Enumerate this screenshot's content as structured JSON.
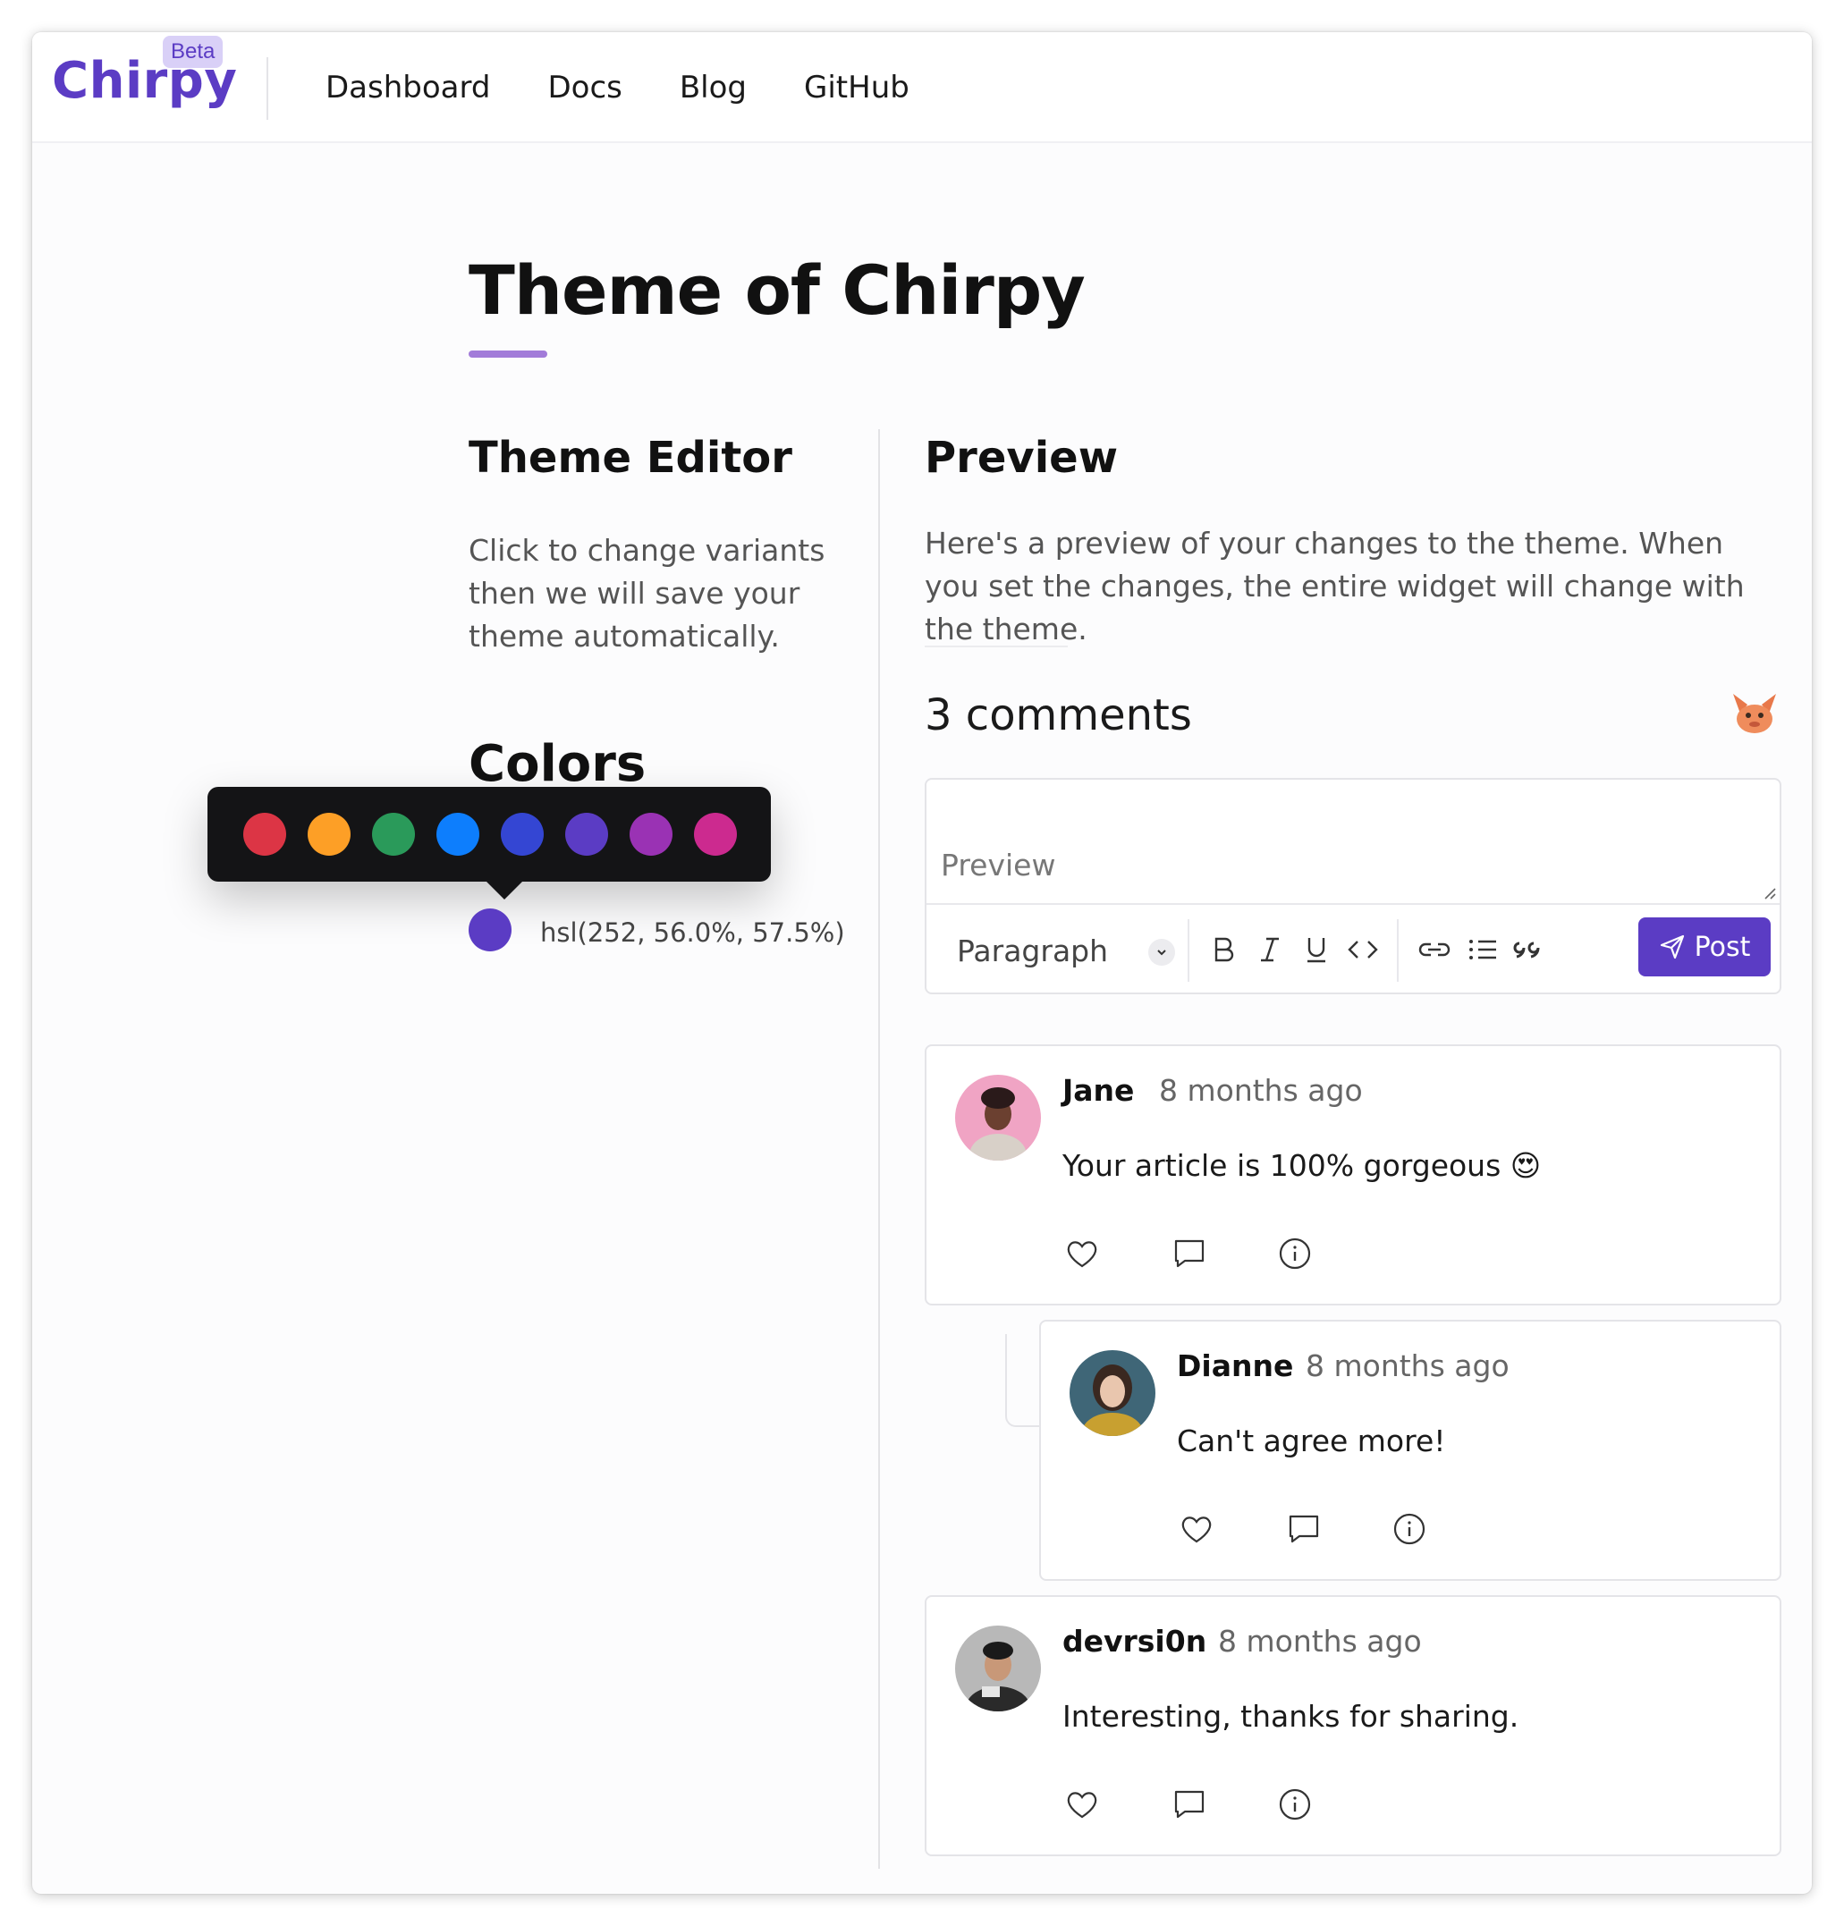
{
  "header": {
    "logo": "Chirpy",
    "badge": "Beta",
    "nav": [
      {
        "label": "Dashboard"
      },
      {
        "label": "Docs"
      },
      {
        "label": "Blog"
      },
      {
        "label": "GitHub"
      }
    ]
  },
  "page": {
    "title": "Theme of Chirpy"
  },
  "editor": {
    "title": "Theme Editor",
    "description": "Click to change variants then we will save your theme automatically.",
    "colors_title": "Colors",
    "palette": [
      "#dc3545",
      "#fd9f26",
      "#2a9a5a",
      "#0d7efd",
      "#3446d3",
      "#5b3cc4",
      "#9a32b4",
      "#cc2a8f"
    ],
    "selected_color": "#5b3cc4",
    "selected_label": "hsl(252, 56.0%, 57.5%)"
  },
  "preview": {
    "title": "Preview",
    "description": "Here's a preview of your changes to the theme. When you set the changes, the entire widget will change with the theme.",
    "comments_count": "3 comments",
    "input_placeholder": "Preview",
    "format_select": "Paragraph",
    "post_label": "Post",
    "accent": "#5b3cc4"
  },
  "comments": [
    {
      "author": "Jane",
      "time": "8 months ago",
      "text": "Your article is 100% gorgeous 😍"
    },
    {
      "author": "Dianne",
      "time": "8 months ago",
      "text": "Can't agree more!"
    },
    {
      "author": "devrsi0n",
      "time": "8 months ago",
      "text": "Interesting, thanks for sharing."
    }
  ]
}
